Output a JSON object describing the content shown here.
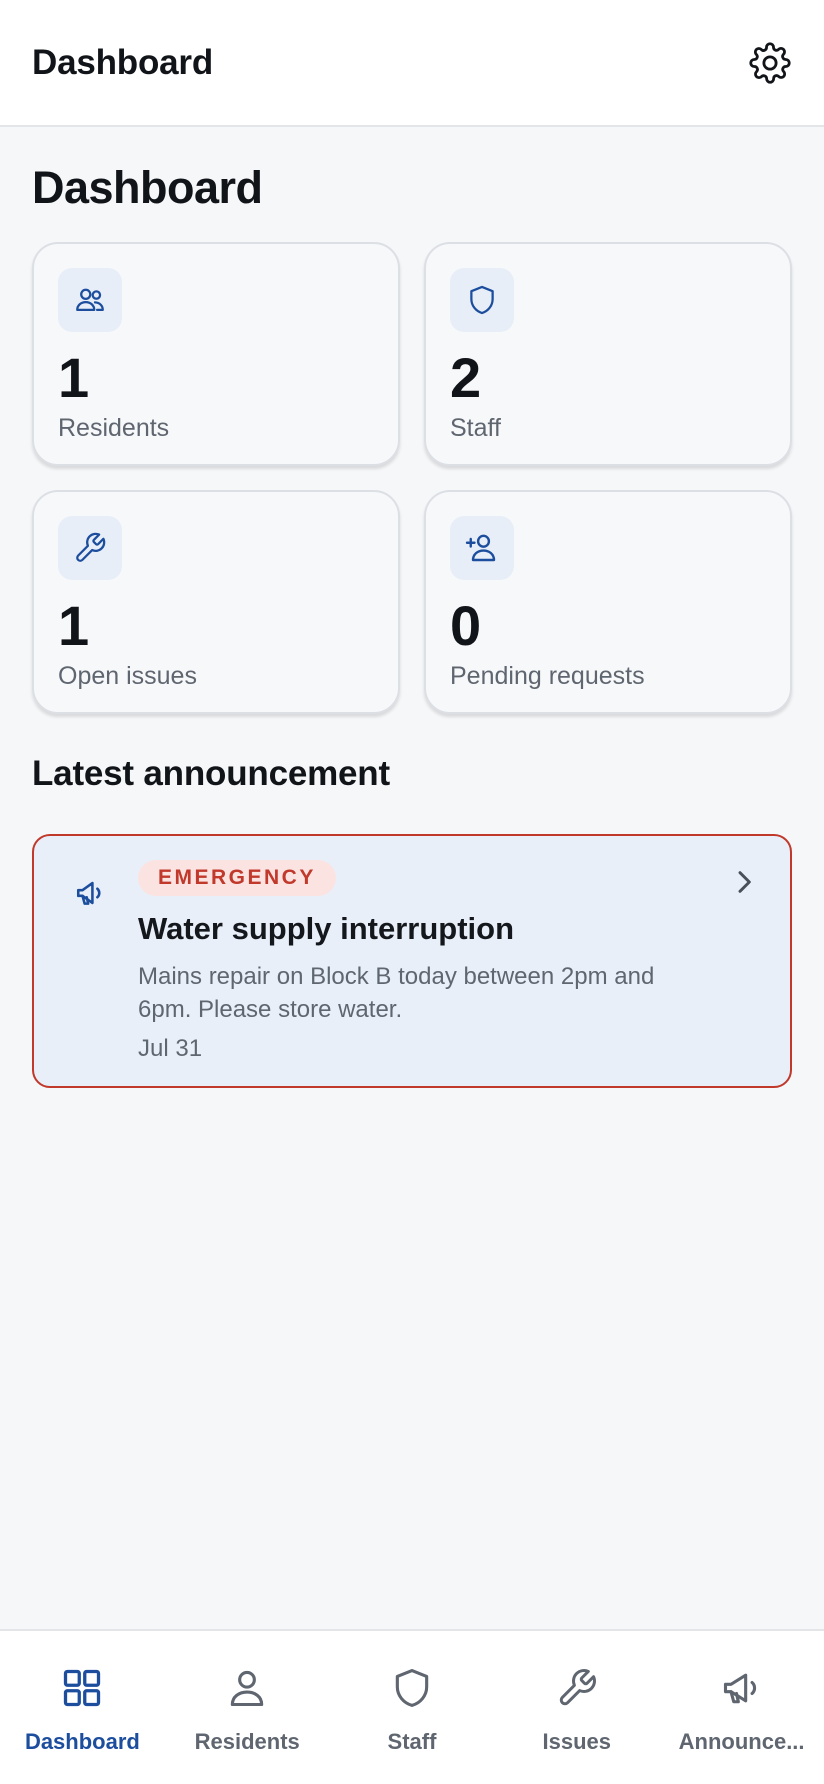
{
  "header": {
    "title": "Dashboard"
  },
  "page": {
    "title": "Dashboard"
  },
  "stats": [
    {
      "value": "1",
      "label": "Residents",
      "icon": "users-icon"
    },
    {
      "value": "2",
      "label": "Staff",
      "icon": "shield-icon"
    },
    {
      "value": "1",
      "label": "Open issues",
      "icon": "wrench-icon"
    },
    {
      "value": "0",
      "label": "Pending requests",
      "icon": "user-plus-icon"
    }
  ],
  "section": {
    "latest_title": "Latest announcement"
  },
  "announcement": {
    "badge": "EMERGENCY",
    "title": "Water supply interruption",
    "description": "Mains repair on Block B today between 2pm and 6pm. Please store water.",
    "date": "Jul 31",
    "icon": "megaphone-icon"
  },
  "nav": [
    {
      "label": "Dashboard",
      "icon": "grid-icon",
      "active": true
    },
    {
      "label": "Residents",
      "icon": "person-icon",
      "active": false
    },
    {
      "label": "Staff",
      "icon": "shield-icon",
      "active": false
    },
    {
      "label": "Issues",
      "icon": "wrench-icon",
      "active": false
    },
    {
      "label": "Announce...",
      "icon": "megaphone-icon",
      "active": false
    }
  ],
  "colors": {
    "accent": "#1d4e9e",
    "emergency": "#c0392b",
    "muted_text": "#5f6670",
    "background": "#f6f7f9"
  }
}
